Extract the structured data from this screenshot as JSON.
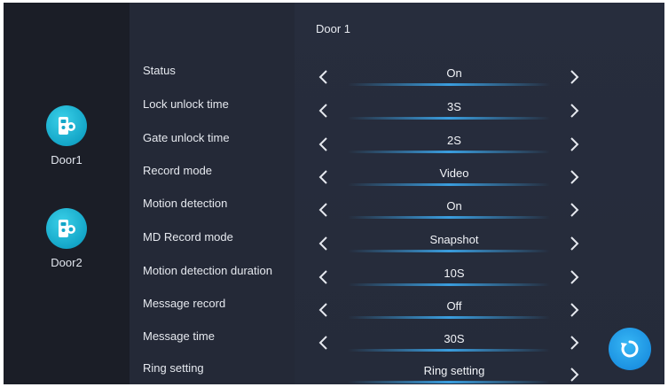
{
  "header": {
    "title": "Door 1"
  },
  "sidebar": {
    "doors": [
      {
        "label": "Door1",
        "icon": "door-phone-icon"
      },
      {
        "label": "Door2",
        "icon": "door-phone-icon"
      }
    ]
  },
  "settings": [
    {
      "label": "Status",
      "value": "On"
    },
    {
      "label": "Lock unlock time",
      "value": "3S"
    },
    {
      "label": "Gate unlock time",
      "value": "2S"
    },
    {
      "label": "Record mode",
      "value": "Video"
    },
    {
      "label": "Motion detection",
      "value": "On"
    },
    {
      "label": "MD Record mode",
      "value": "Snapshot"
    },
    {
      "label": "Motion detection duration",
      "value": "10S"
    },
    {
      "label": "Message record",
      "value": "Off"
    },
    {
      "label": "Message time",
      "value": "30S"
    },
    {
      "label": "Ring setting",
      "value": "Ring setting"
    }
  ],
  "colors": {
    "accent": "#1a8fe0",
    "icon_teal": "#14a6c8",
    "background": "#1f2330"
  },
  "icons": {
    "prev": "chevron-left-icon",
    "next": "chevron-right-icon",
    "refresh": "refresh-icon"
  }
}
